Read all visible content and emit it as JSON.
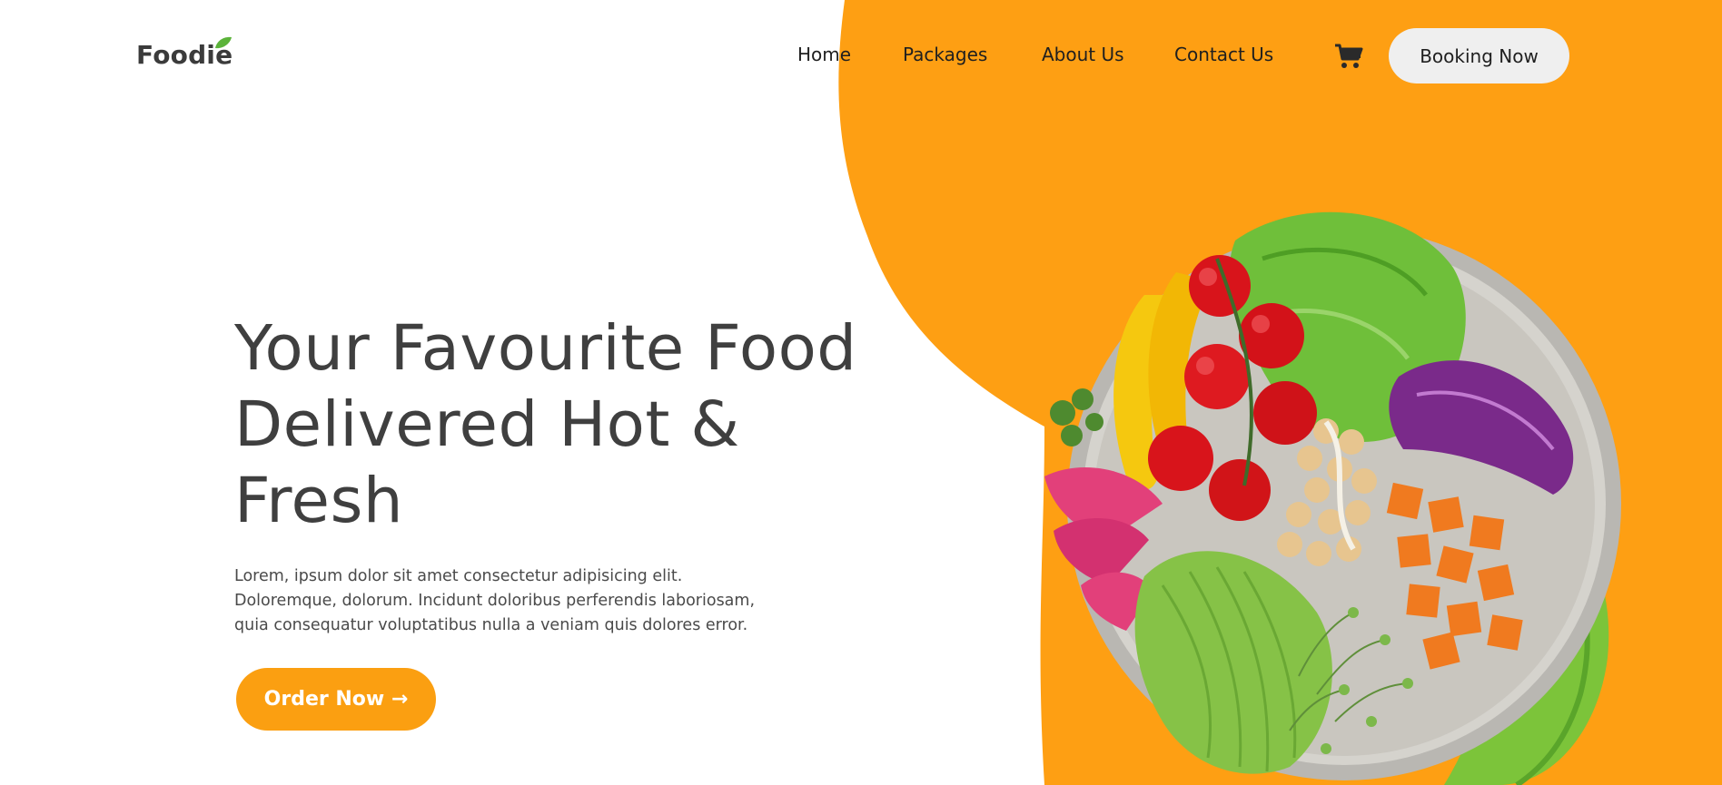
{
  "brand": {
    "logo_text": "Foodie",
    "accent_color": "#fb9f11",
    "blob_color": "#fe9f13"
  },
  "nav": {
    "links": [
      {
        "label": "Home"
      },
      {
        "label": "Packages"
      },
      {
        "label": "About Us"
      },
      {
        "label": "Contact Us"
      }
    ],
    "cart_icon": "cart-icon",
    "booking_label": "Booking Now"
  },
  "hero": {
    "title_line1": "Your Favourite Food",
    "title_line2": "Delivered Hot &",
    "title_line3": "Fresh",
    "description_line1": "Lorem, ipsum dolor sit amet consectetur adipisicing elit.",
    "description_line2": "Doloremque, dolorum. Incidunt doloribus perferendis laboriosam,",
    "description_line3": "quia consequatur voluptatibus nulla a veniam quis dolores error.",
    "order_label": "Order Now →"
  },
  "image": {
    "icon": "salad-bowl-image"
  }
}
